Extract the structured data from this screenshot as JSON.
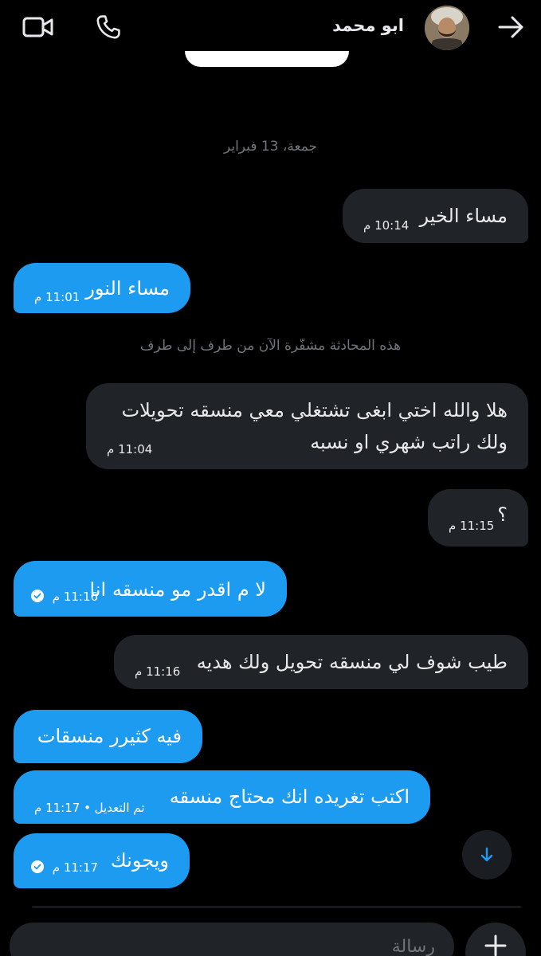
{
  "header": {
    "contact_name": "ابو محمد",
    "back_icon": "arrow-right-icon",
    "call_icon": "phone-icon",
    "video_icon": "video-camera-icon"
  },
  "conversation": {
    "date_separator": "جمعة، 13 فبراير",
    "encryption_notice": "هذه المحادثة مشفّرة الآن من طرف إلى طرف",
    "messages": [
      {
        "direction": "incoming",
        "text": "مساء الخير",
        "time": "10:14 م"
      },
      {
        "direction": "outgoing",
        "text": "مساء النور",
        "time": "11:01 م"
      },
      {
        "direction": "incoming",
        "text": "هلا والله اختي ابغى تشتغلي معي منسقه تحويلات ولك راتب شهري او نسبه",
        "time": "11:04 م"
      },
      {
        "direction": "incoming",
        "text": "؟",
        "time": "11:15 م"
      },
      {
        "direction": "outgoing",
        "text": "لا م اقدر مو منسقه انا",
        "time": "11:16 م",
        "read": true
      },
      {
        "direction": "incoming",
        "text": "طيب شوف لي منسقه تحويل ولك هديه",
        "time": "11:16 م"
      },
      {
        "direction": "outgoing",
        "text": "فيه كثيرر منسقات",
        "time": ""
      },
      {
        "direction": "outgoing",
        "text": "اكتب تغريده انك محتاج منسقه",
        "time": "تم التعديل • 11:17 م"
      },
      {
        "direction": "outgoing",
        "text": "ويجونك",
        "time": "11:17 م",
        "read": true
      }
    ]
  },
  "composer": {
    "placeholder": "رسالة",
    "add_icon": "plus-icon",
    "scroll_icon": "arrow-down-icon"
  },
  "colors": {
    "background": "#000000",
    "incoming_bubble": "#202327",
    "outgoing_bubble": "#1d9bf0",
    "muted_text": "#71767b"
  }
}
